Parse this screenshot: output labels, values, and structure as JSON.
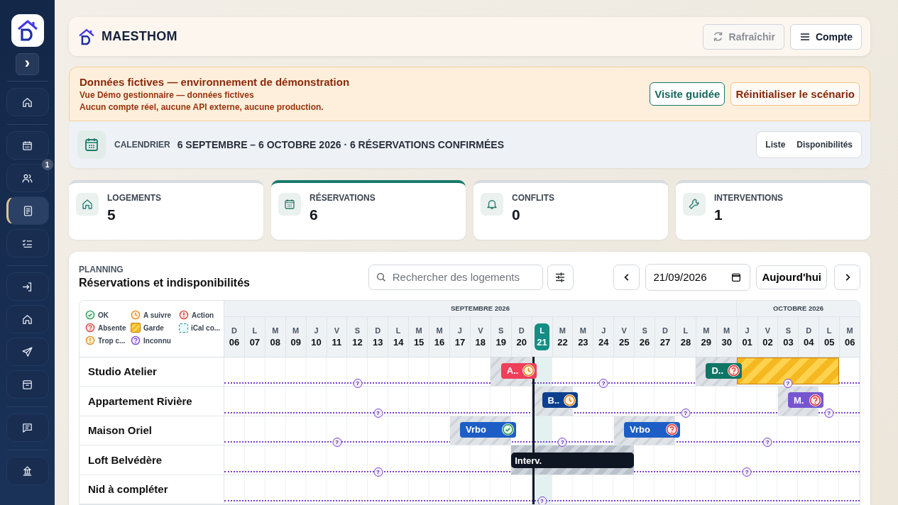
{
  "sidebar": {
    "expand_button": "›",
    "groups": [
      [
        {
          "selected": false
        }
      ],
      [
        {
          "selected": false
        },
        {
          "selected": false,
          "badge": "1"
        },
        {
          "selected": true
        },
        {
          "selected": false
        }
      ],
      [
        {
          "selected": false
        },
        {
          "selected": false
        },
        {
          "selected": false
        },
        {
          "selected": false
        }
      ],
      [
        {
          "selected": false
        }
      ],
      [
        {
          "selected": false
        }
      ]
    ]
  },
  "header": {
    "brand": "MAESTHOM",
    "buttons": [
      {
        "label": "Rafraîchir",
        "disabled": true
      },
      {
        "label": "Compte",
        "disabled": false
      }
    ]
  },
  "banner": {
    "title": "Données fictives — environnement de démonstration",
    "lines": [
      "Vue Démo gestionnaire — données fictives",
      "Aucun compte réel, aucune API externe, aucune production."
    ],
    "buttons": [
      {
        "label": "Visite guidée",
        "kind": "primary"
      },
      {
        "label": "Réinitialiser le scénario",
        "kind": "secondary"
      }
    ]
  },
  "calendar_bar": {
    "label": "CALENDRIER",
    "summary": "6 SEPTEMBRE – 6 OCTOBRE 2026 · 6 RÉSERVATIONS CONFIRMÉES",
    "views": [
      {
        "label": "Liste",
        "selected": false
      },
      {
        "label": "Disponibilités",
        "selected": false
      }
    ]
  },
  "stats": [
    {
      "label": "LOGEMENTS",
      "value": "5",
      "selected": false
    },
    {
      "label": "RÉSERVATIONS",
      "value": "6",
      "selected": true
    },
    {
      "label": "CONFLITS",
      "value": "0",
      "selected": false
    },
    {
      "label": "INTERVENTIONS",
      "value": "1",
      "selected": false
    }
  ],
  "planning": {
    "eyebrow": "PLANNING",
    "title": "Réservations et indisponibilités",
    "search": {
      "placeholder": "Rechercher des logements"
    },
    "date": {
      "value": "21/09/2026"
    },
    "today_button": "Aujourd'hui",
    "legend": [
      {
        "label": "OK",
        "kind": "ok"
      },
      {
        "label": "A suivre",
        "kind": "a_suivre"
      },
      {
        "label": "Action",
        "kind": "action"
      },
      {
        "label": "Absente",
        "kind": "absente"
      },
      {
        "label": "Garde",
        "kind": "garde"
      },
      {
        "label": "iCal co...",
        "kind": "ical"
      },
      {
        "label": "Trop c...",
        "kind": "trop"
      },
      {
        "label": "Inconnu",
        "kind": "inconnu"
      }
    ],
    "months": [
      {
        "label": "SEPTEMBRE 2026",
        "days": [
          {
            "letter": "D",
            "num": "06",
            "today": false
          },
          {
            "letter": "L",
            "num": "07",
            "today": false
          },
          {
            "letter": "M",
            "num": "08",
            "today": false
          },
          {
            "letter": "M",
            "num": "09",
            "today": false
          },
          {
            "letter": "J",
            "num": "10",
            "today": false
          },
          {
            "letter": "V",
            "num": "11",
            "today": false
          },
          {
            "letter": "S",
            "num": "12",
            "today": false
          },
          {
            "letter": "D",
            "num": "13",
            "today": false
          },
          {
            "letter": "L",
            "num": "14",
            "today": false
          },
          {
            "letter": "M",
            "num": "15",
            "today": false
          },
          {
            "letter": "M",
            "num": "16",
            "today": false
          },
          {
            "letter": "J",
            "num": "17",
            "today": false
          },
          {
            "letter": "V",
            "num": "18",
            "today": false
          },
          {
            "letter": "S",
            "num": "19",
            "today": false
          },
          {
            "letter": "D",
            "num": "20",
            "today": false
          },
          {
            "letter": "L",
            "num": "21",
            "today": true
          },
          {
            "letter": "M",
            "num": "22",
            "today": false
          },
          {
            "letter": "M",
            "num": "23",
            "today": false
          },
          {
            "letter": "J",
            "num": "24",
            "today": false
          },
          {
            "letter": "V",
            "num": "25",
            "today": false
          },
          {
            "letter": "S",
            "num": "26",
            "today": false
          },
          {
            "letter": "D",
            "num": "27",
            "today": false
          },
          {
            "letter": "L",
            "num": "28",
            "today": false
          },
          {
            "letter": "M",
            "num": "29",
            "today": false
          },
          {
            "letter": "M",
            "num": "30",
            "today": false
          }
        ]
      },
      {
        "label": "OCTOBRE 2026",
        "days": [
          {
            "letter": "J",
            "num": "01",
            "today": false
          },
          {
            "letter": "V",
            "num": "02",
            "today": false
          },
          {
            "letter": "S",
            "num": "03",
            "today": false
          },
          {
            "letter": "D",
            "num": "04",
            "today": false
          },
          {
            "letter": "L",
            "num": "05",
            "today": false
          },
          {
            "letter": "M",
            "num": "06",
            "today": false
          }
        ]
      }
    ],
    "rows": [
      {
        "name": "Studio Atelier",
        "cells": [
          {
            "kind": "free"
          },
          {
            "kind": "free"
          },
          {
            "kind": "free"
          },
          {
            "kind": "free"
          },
          {
            "kind": "free"
          },
          {
            "kind": "free"
          },
          {
            "kind": "free",
            "marker": "?"
          },
          {
            "kind": "free"
          },
          {
            "kind": "free"
          },
          {
            "kind": "free"
          },
          {
            "kind": "free"
          },
          {
            "kind": "free"
          },
          {
            "kind": "free"
          },
          {
            "kind": "stay",
            "booking": {
              "label": "A..",
              "color": "#ef3f5a",
              "icon": {
                "kind": "a_suivre"
              }
            }
          },
          {
            "kind": "stay"
          },
          {
            "kind": "free"
          },
          {
            "kind": "free"
          },
          {
            "kind": "free"
          },
          {
            "kind": "free",
            "marker": "?"
          },
          {
            "kind": "free"
          },
          {
            "kind": "free"
          },
          {
            "kind": "free"
          },
          {
            "kind": "free"
          },
          {
            "kind": "stay",
            "booking": {
              "label": "D..",
              "color": "#0f7566",
              "icon": {
                "kind": "absente"
              }
            }
          },
          {
            "kind": "stay"
          },
          {
            "kind": "garde"
          },
          {
            "kind": "garde"
          },
          {
            "kind": "garde",
            "marker": "?"
          },
          {
            "kind": "garde"
          },
          {
            "kind": "garde"
          },
          {
            "kind": "free"
          }
        ]
      },
      {
        "name": "Appartement Rivière",
        "cells": [
          {
            "kind": "free"
          },
          {
            "kind": "free"
          },
          {
            "kind": "free"
          },
          {
            "kind": "free"
          },
          {
            "kind": "free"
          },
          {
            "kind": "free"
          },
          {
            "kind": "free"
          },
          {
            "kind": "free",
            "marker": "?"
          },
          {
            "kind": "free"
          },
          {
            "kind": "free"
          },
          {
            "kind": "free"
          },
          {
            "kind": "free"
          },
          {
            "kind": "free"
          },
          {
            "kind": "free"
          },
          {
            "kind": "free"
          },
          {
            "kind": "stay",
            "booking": {
              "label": "B..",
              "color": "#0c3f8e",
              "icon": {
                "kind": "a_suivre"
              }
            }
          },
          {
            "kind": "stay"
          },
          {
            "kind": "free"
          },
          {
            "kind": "free"
          },
          {
            "kind": "free"
          },
          {
            "kind": "free"
          },
          {
            "kind": "free"
          },
          {
            "kind": "free",
            "marker": "?"
          },
          {
            "kind": "free"
          },
          {
            "kind": "free"
          },
          {
            "kind": "free"
          },
          {
            "kind": "free"
          },
          {
            "kind": "stay",
            "booking": {
              "label": "M.",
              "color": "#7656cf",
              "icon": {
                "kind": "absente"
              }
            }
          },
          {
            "kind": "stay"
          },
          {
            "kind": "free",
            "marker": "?"
          },
          {
            "kind": "free"
          }
        ]
      },
      {
        "name": "Maison Oriel",
        "cells": [
          {
            "kind": "free"
          },
          {
            "kind": "free"
          },
          {
            "kind": "free"
          },
          {
            "kind": "free"
          },
          {
            "kind": "free"
          },
          {
            "kind": "free",
            "marker": "?"
          },
          {
            "kind": "free"
          },
          {
            "kind": "free"
          },
          {
            "kind": "free"
          },
          {
            "kind": "free"
          },
          {
            "kind": "free"
          },
          {
            "kind": "stay",
            "booking": {
              "label": "Vrbo",
              "color": "#1d5ec6",
              "icon": {
                "kind": "ok"
              }
            }
          },
          {
            "kind": "stay"
          },
          {
            "kind": "stay"
          },
          {
            "kind": "free"
          },
          {
            "kind": "free"
          },
          {
            "kind": "free",
            "marker": "?"
          },
          {
            "kind": "free"
          },
          {
            "kind": "free"
          },
          {
            "kind": "stay",
            "booking": {
              "label": "Vrbo",
              "color": "#1d5ec6",
              "icon": {
                "kind": "absente"
              }
            }
          },
          {
            "kind": "stay"
          },
          {
            "kind": "stay"
          },
          {
            "kind": "free"
          },
          {
            "kind": "free"
          },
          {
            "kind": "free"
          },
          {
            "kind": "free"
          },
          {
            "kind": "free",
            "marker": "?"
          },
          {
            "kind": "free"
          },
          {
            "kind": "free"
          },
          {
            "kind": "free"
          },
          {
            "kind": "free"
          }
        ]
      },
      {
        "name": "Loft Belvédère",
        "cells": [
          {
            "kind": "free"
          },
          {
            "kind": "free"
          },
          {
            "kind": "free"
          },
          {
            "kind": "free"
          },
          {
            "kind": "free"
          },
          {
            "kind": "free"
          },
          {
            "kind": "free"
          },
          {
            "kind": "free",
            "marker": "?"
          },
          {
            "kind": "free"
          },
          {
            "kind": "free"
          },
          {
            "kind": "free"
          },
          {
            "kind": "free"
          },
          {
            "kind": "free"
          },
          {
            "kind": "free"
          },
          {
            "kind": "intervention",
            "booking": {
              "label": "Interv."
            }
          },
          {
            "kind": "intervention"
          },
          {
            "kind": "intervention"
          },
          {
            "kind": "intervention"
          },
          {
            "kind": "intervention"
          },
          {
            "kind": "intervention"
          },
          {
            "kind": "free"
          },
          {
            "kind": "free"
          },
          {
            "kind": "free"
          },
          {
            "kind": "free"
          },
          {
            "kind": "free"
          },
          {
            "kind": "free",
            "marker": "?"
          },
          {
            "kind": "free"
          },
          {
            "kind": "free"
          },
          {
            "kind": "free"
          },
          {
            "kind": "free"
          },
          {
            "kind": "free"
          }
        ]
      },
      {
        "name": "Nid à compléter",
        "cells": [
          {
            "kind": "free"
          },
          {
            "kind": "free"
          },
          {
            "kind": "free"
          },
          {
            "kind": "free"
          },
          {
            "kind": "free"
          },
          {
            "kind": "free"
          },
          {
            "kind": "free"
          },
          {
            "kind": "free"
          },
          {
            "kind": "free"
          },
          {
            "kind": "free"
          },
          {
            "kind": "free"
          },
          {
            "kind": "free"
          },
          {
            "kind": "free"
          },
          {
            "kind": "free"
          },
          {
            "kind": "free"
          },
          {
            "kind": "free",
            "marker": "?"
          },
          {
            "kind": "free"
          },
          {
            "kind": "free"
          },
          {
            "kind": "free"
          },
          {
            "kind": "free"
          },
          {
            "kind": "free"
          },
          {
            "kind": "free"
          },
          {
            "kind": "free"
          },
          {
            "kind": "free"
          },
          {
            "kind": "free"
          },
          {
            "kind": "free"
          },
          {
            "kind": "free"
          },
          {
            "kind": "free"
          },
          {
            "kind": "free"
          },
          {
            "kind": "free"
          },
          {
            "kind": "free"
          }
        ]
      }
    ]
  }
}
